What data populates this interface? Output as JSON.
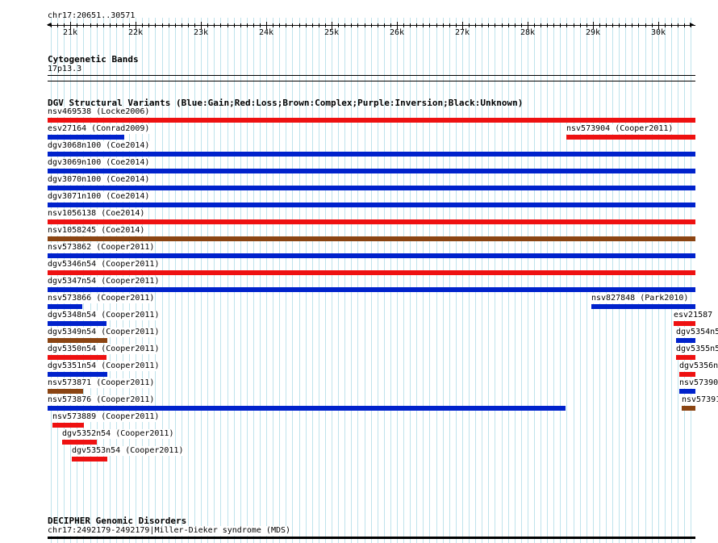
{
  "ruler": {
    "position_label": "chr17:20651..30571",
    "start": 20651,
    "end": 30571,
    "ticks": [
      "21k",
      "22k",
      "23k",
      "24k",
      "25k",
      "26k",
      "27k",
      "28k",
      "29k",
      "30k"
    ]
  },
  "tracks": {
    "cytogenetic": {
      "title": "Cytogenetic Bands",
      "band": "17p13.3"
    },
    "dgv": {
      "title": "DGV Structural Variants (Blue:Gain;Red:Loss;Brown:Complex;Purple:Inversion;Black:Unknown)",
      "colors": {
        "gain": "#0022cc",
        "loss": "#ee1111",
        "complex": "#8b4513"
      },
      "features": [
        {
          "label": "nsv469538 (Locke2006)",
          "type": "loss",
          "start": 20651,
          "end": 30571
        },
        {
          "label": "esv27164 (Conrad2009)",
          "type": "gain",
          "start": 20651,
          "end": 21830
        },
        {
          "label": "nsv573904 (Cooper2011)",
          "type": "loss",
          "start": 28600,
          "end": 30571
        },
        {
          "label": "dgv3068n100 (Coe2014)",
          "type": "gain",
          "start": 20651,
          "end": 30571
        },
        {
          "label": "dgv3069n100 (Coe2014)",
          "type": "gain",
          "start": 20651,
          "end": 30571
        },
        {
          "label": "dgv3070n100 (Coe2014)",
          "type": "gain",
          "start": 20651,
          "end": 30571
        },
        {
          "label": "dgv3071n100 (Coe2014)",
          "type": "gain",
          "start": 20651,
          "end": 30571
        },
        {
          "label": "nsv1056138 (Coe2014)",
          "type": "loss",
          "start": 20651,
          "end": 30571
        },
        {
          "label": "nsv1058245 (Coe2014)",
          "type": "complex",
          "start": 20651,
          "end": 30571
        },
        {
          "label": "nsv573862 (Cooper2011)",
          "type": "gain",
          "start": 20651,
          "end": 30571
        },
        {
          "label": "dgv5346n54 (Cooper2011)",
          "type": "loss",
          "start": 20651,
          "end": 30571
        },
        {
          "label": "dgv5347n54 (Cooper2011)",
          "type": "gain",
          "start": 20651,
          "end": 30571
        },
        {
          "label": "nsv573866 (Cooper2011)",
          "type": "gain",
          "start": 20651,
          "end": 21180
        },
        {
          "label": "nsv827848 (Park2010)",
          "type": "gain",
          "start": 28980,
          "end": 30571
        },
        {
          "label": "dgv5348n54 (Cooper2011)",
          "type": "gain",
          "start": 20651,
          "end": 21550
        },
        {
          "label": "esv21587 (",
          "type": "loss",
          "start": 30240,
          "end": 30590
        },
        {
          "label": "dgv5349n54 (Cooper2011)",
          "type": "complex",
          "start": 20651,
          "end": 21560
        },
        {
          "label": "dgv5354n5",
          "type": "gain",
          "start": 30270,
          "end": 30580
        },
        {
          "label": "dgv5350n54 (Cooper2011)",
          "type": "loss",
          "start": 20651,
          "end": 21550
        },
        {
          "label": "dgv5355n5",
          "type": "loss",
          "start": 30270,
          "end": 30580
        },
        {
          "label": "dgv5351n54 (Cooper2011)",
          "type": "gain",
          "start": 20651,
          "end": 21560
        },
        {
          "label": "dgv5356n5",
          "type": "loss",
          "start": 30320,
          "end": 30580
        },
        {
          "label": "nsv573871 (Cooper2011)",
          "type": "complex",
          "start": 20651,
          "end": 21200
        },
        {
          "label": "nsv57390",
          "type": "gain",
          "start": 30320,
          "end": 30590
        },
        {
          "label": "nsv573876 (Cooper2011)",
          "type": "gain",
          "start": 20651,
          "end": 28580
        },
        {
          "label": "nsv57391",
          "type": "complex",
          "start": 30360,
          "end": 30590
        },
        {
          "label": "nsv573889 (Cooper2011)",
          "type": "loss",
          "start": 20720,
          "end": 21200
        },
        {
          "label": "dgv5352n54 (Cooper2011)",
          "type": "loss",
          "start": 20870,
          "end": 21400
        },
        {
          "label": "dgv5353n54 (Cooper2011)",
          "type": "loss",
          "start": 21020,
          "end": 21560
        }
      ]
    },
    "decipher": {
      "title": "DECIPHER Genomic Disorders",
      "feature_label": "chr17:2492179-2492179|Miller-Dieker syndrome (MDS)"
    }
  }
}
